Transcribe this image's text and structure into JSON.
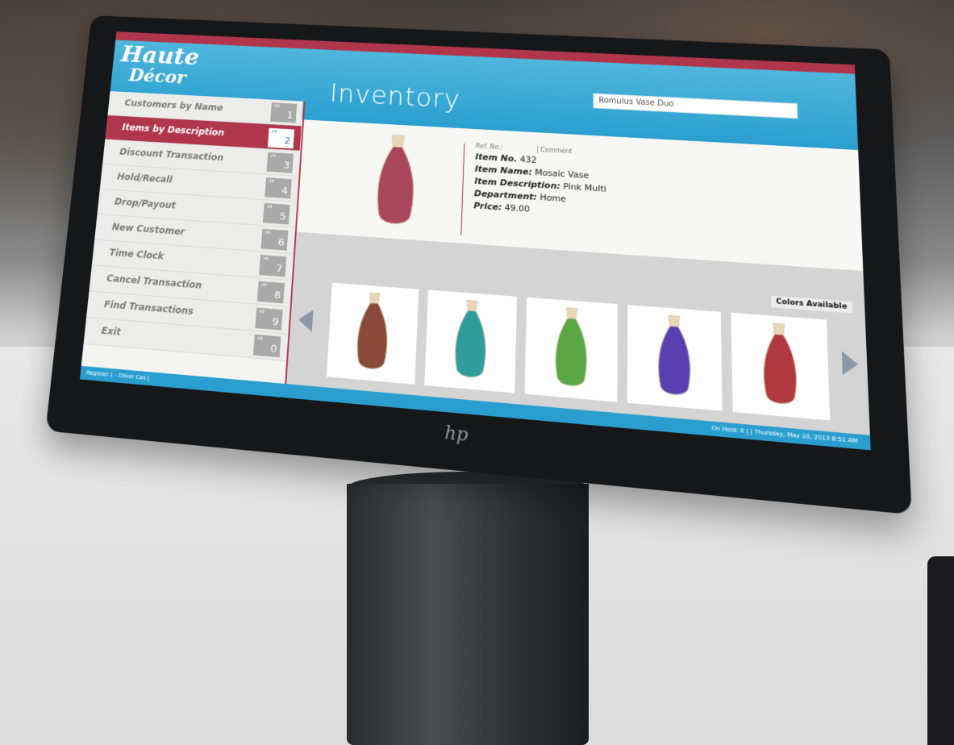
{
  "app": {
    "brand_line1": "Haute",
    "brand_line2": "Décor",
    "page_title": "Inventory",
    "search_value": "Romulus Vase Duo",
    "accent_color": "#b0364c",
    "header_color": "#2a9fcf"
  },
  "menu": {
    "items": [
      {
        "label": "Customers by Name",
        "key": "1"
      },
      {
        "label": "Items by Description",
        "key": "2"
      },
      {
        "label": "Discount Transaction",
        "key": "3"
      },
      {
        "label": "Hold/Recall",
        "key": "4"
      },
      {
        "label": "Drop/Payout",
        "key": "5"
      },
      {
        "label": "New Customer",
        "key": "6"
      },
      {
        "label": "Time Clock",
        "key": "7"
      },
      {
        "label": "Cancel Transaction",
        "key": "8"
      },
      {
        "label": "Find Transactions",
        "key": "9"
      },
      {
        "label": "Exit",
        "key": "0"
      }
    ],
    "active_index": 1
  },
  "item": {
    "ref_label": "Ref. No.:",
    "comment_label": "| Comment",
    "item_no_label": "Item No.",
    "item_no": "432",
    "item_name_label": "Item Name:",
    "item_name": "Mosaic Vase",
    "item_desc_label": "Item Description:",
    "item_desc": "Pink Multi",
    "department_label": "Department:",
    "department": "Home",
    "price_label": "Price:",
    "price": "49.00"
  },
  "gallery": {
    "colors_label": "Colors Available",
    "swatches": [
      "#8a4a3a",
      "#2f9e9a",
      "#5aa644",
      "#5a3fb0",
      "#b03a40"
    ]
  },
  "status": {
    "left": "Register 1 - Oliver Cox |",
    "right": "On Hold: 0 | | Thursday, May 10, 2013 8:51 AM"
  },
  "device": {
    "logo_text": "hp"
  }
}
